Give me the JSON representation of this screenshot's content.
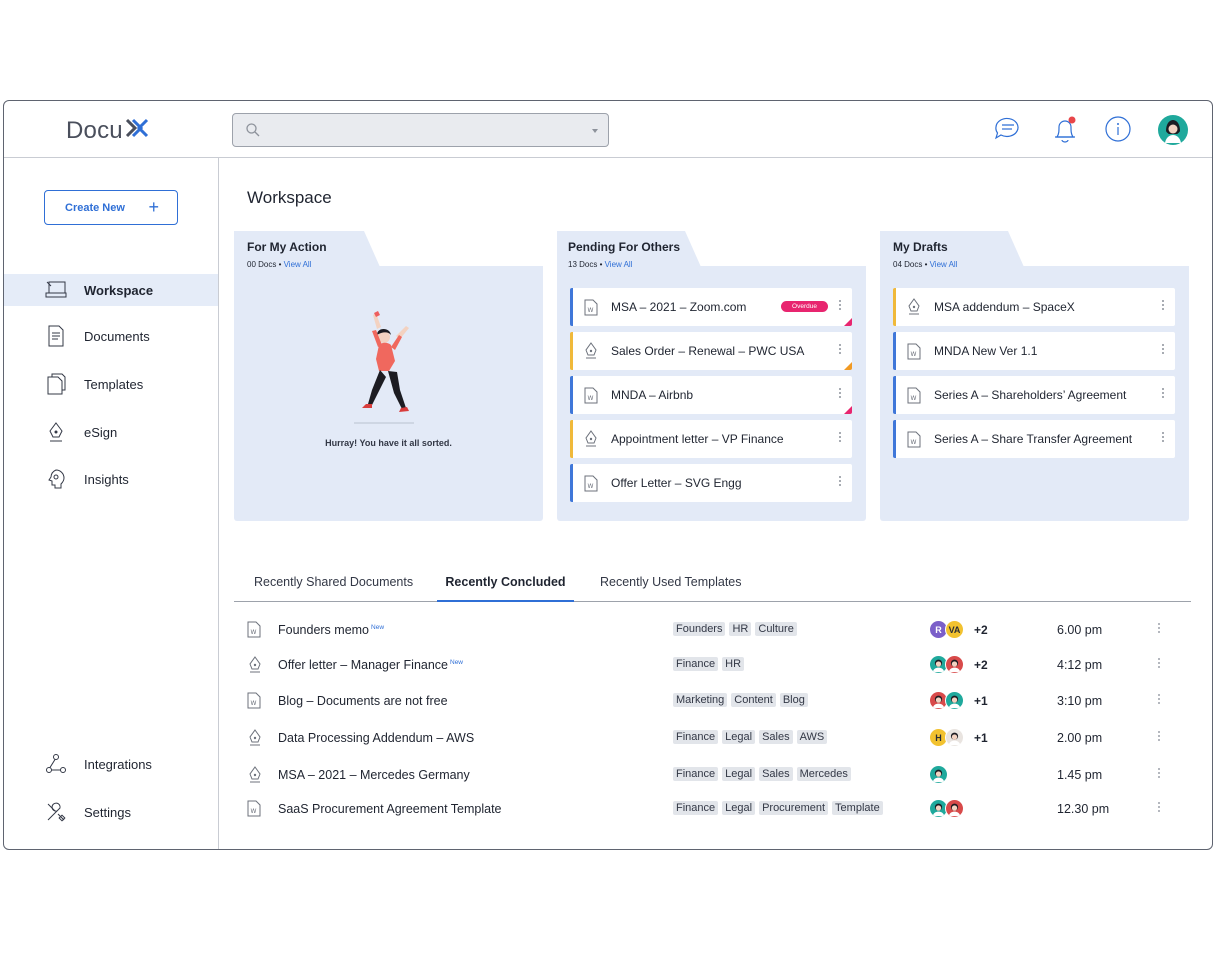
{
  "app": {
    "logo_text": "Docu",
    "logo_mark": "X"
  },
  "search": {
    "placeholder": "",
    "value": ""
  },
  "header_icons": [
    "chat-icon",
    "bell-icon",
    "info-icon",
    "user-avatar"
  ],
  "colors": {
    "accent": "#2f6fd6",
    "panel_bg": "#e3eaf7",
    "overdue": "#e8256f",
    "yellow_bar": "#f0b93a"
  },
  "sidebar": {
    "create_label": "Create New",
    "items": [
      {
        "label": "Workspace",
        "icon": "workspace-icon",
        "active": true
      },
      {
        "label": "Documents",
        "icon": "documents-icon"
      },
      {
        "label": "Templates",
        "icon": "templates-icon"
      },
      {
        "label": "eSign",
        "icon": "esign-icon"
      },
      {
        "label": "Insights",
        "icon": "insights-icon"
      }
    ],
    "bottom_items": [
      {
        "label": "Integrations",
        "icon": "integrations-icon"
      },
      {
        "label": "Settings",
        "icon": "settings-icon"
      }
    ]
  },
  "main": {
    "title": "Workspace",
    "panels": [
      {
        "title": "For My Action",
        "count": "00 Docs",
        "view_all": "View All",
        "empty_message": "Hurray! You have it all sorted.",
        "docs": []
      },
      {
        "title": "Pending For Others",
        "count": "13 Docs",
        "view_all": "View All",
        "docs": [
          {
            "name": "MSA – 2021 – Zoom.com",
            "type": "word",
            "badge": "Overdue"
          },
          {
            "name": "Sales Order – Renewal – PWC USA",
            "type": "esign"
          },
          {
            "name": "MNDA – Airbnb",
            "type": "word"
          },
          {
            "name": "Appointment letter – VP Finance",
            "type": "esign"
          },
          {
            "name": "Offer Letter – SVG Engg",
            "type": "word"
          }
        ]
      },
      {
        "title": "My Drafts",
        "count": "04 Docs",
        "view_all": "View All",
        "docs": [
          {
            "name": "MSA addendum – SpaceX",
            "type": "esign"
          },
          {
            "name": "MNDA New Ver 1.1",
            "type": "word"
          },
          {
            "name": "Series A – Shareholders’ Agreement",
            "type": "word"
          },
          {
            "name": "Series A – Share Transfer Agreement",
            "type": "word"
          }
        ]
      }
    ],
    "tabs": [
      {
        "label": "Recently Shared Documents"
      },
      {
        "label": "Recently Concluded",
        "active": true
      },
      {
        "label": "Recently Used Templates"
      }
    ],
    "rows": [
      {
        "name": "Founders memo",
        "new": "New",
        "type": "word",
        "tags": [
          "Founders",
          "HR",
          "Culture"
        ],
        "avatars": [
          "R",
          "VA"
        ],
        "more": "+2",
        "time": "6.00 pm"
      },
      {
        "name": "Offer letter – Manager Finance",
        "new": "New",
        "type": "esign",
        "tags": [
          "Finance",
          "HR"
        ],
        "avatars": [
          "photo",
          "photo"
        ],
        "more": "+2",
        "time": "4:12 pm"
      },
      {
        "name": "Blog – Documents are not free",
        "type": "word",
        "tags": [
          "Marketing",
          "Content",
          "Blog"
        ],
        "avatars": [
          "photo",
          "photo"
        ],
        "more": "+1",
        "time": "3:10 pm"
      },
      {
        "name": "Data Processing Addendum – AWS",
        "type": "esign",
        "tags": [
          "Finance",
          "Legal",
          "Sales",
          "AWS"
        ],
        "avatars": [
          "H",
          "photo"
        ],
        "more": "+1",
        "time": "2.00 pm"
      },
      {
        "name": "MSA – 2021 – Mercedes Germany",
        "type": "esign",
        "tags": [
          "Finance",
          "Legal",
          "Sales",
          "Mercedes"
        ],
        "avatars": [
          "photo"
        ],
        "more": "",
        "time": "1.45 pm"
      },
      {
        "name": "SaaS Procurement Agreement Template",
        "type": "word",
        "tags": [
          "Finance",
          "Legal",
          "Procurement",
          "Template"
        ],
        "avatars": [
          "photo",
          "photo"
        ],
        "more": "",
        "time": "12.30 pm"
      }
    ]
  }
}
